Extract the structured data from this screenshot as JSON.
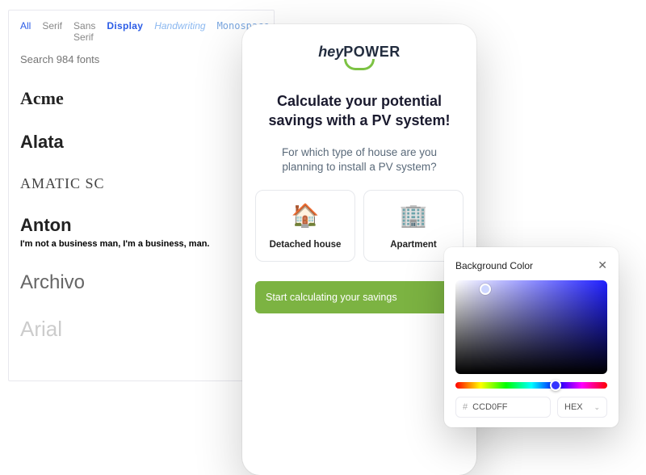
{
  "font_picker": {
    "tabs": {
      "all": "All",
      "serif": "Serif",
      "sans": "Sans Serif",
      "display": "Display",
      "handwriting": "Handwriting",
      "monospace": "Monospace"
    },
    "search_placeholder": "Search 984 fonts",
    "fonts": {
      "acme": "Acme",
      "alata": "Alata",
      "amatic": "Amatic SC",
      "anton": "Anton",
      "anton_sample": "I'm not a business man, I'm a business, man.",
      "archivo": "Archivo",
      "arial": "Arial"
    }
  },
  "phone": {
    "logo_hey": "hey",
    "logo_power": "POWER",
    "title": "Calculate your potential savings with a PV system!",
    "subtitle": "For which type of house are you planning to install a PV system?",
    "options": {
      "detached": {
        "emoji": "🏠",
        "label": "Detached house"
      },
      "apartment": {
        "emoji": "🏢",
        "label": "Apartment"
      }
    },
    "cta": "Start calculating your savings"
  },
  "color_picker": {
    "title": "Background Color",
    "hex_value": "CCD0FF",
    "hash": "#",
    "format": "HEX"
  }
}
